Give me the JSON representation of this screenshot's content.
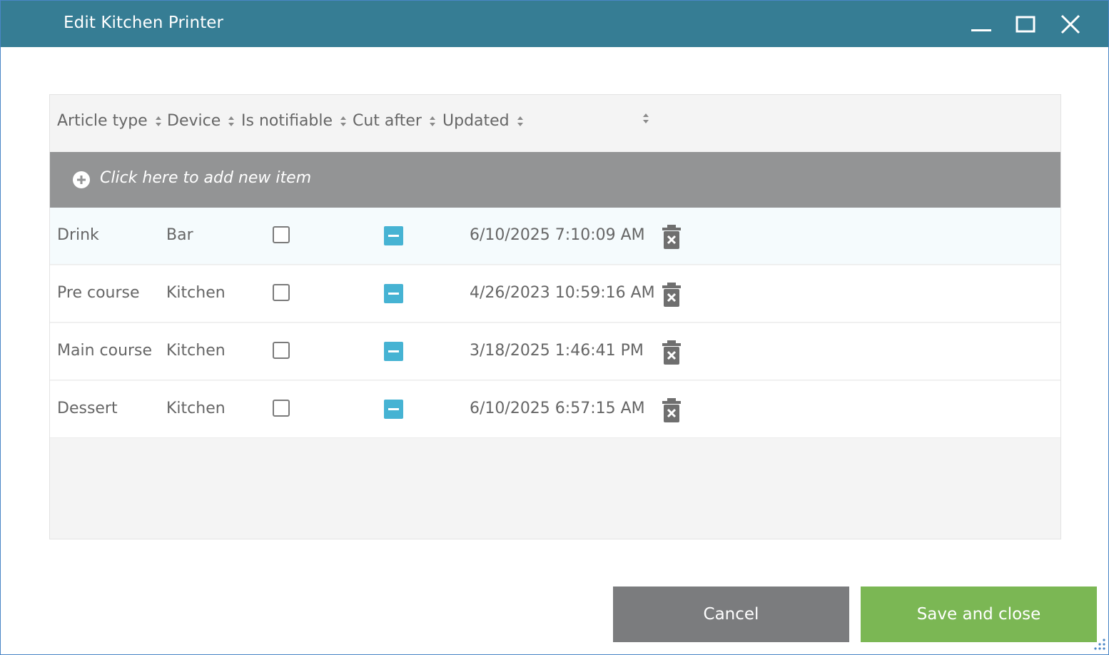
{
  "window": {
    "title": "Edit Kitchen Printer",
    "controls": [
      "minimize-icon",
      "maximize-icon",
      "close-icon"
    ]
  },
  "grid": {
    "columns": [
      {
        "label": "Article type"
      },
      {
        "label": "Device"
      },
      {
        "label": "Is notifiable"
      },
      {
        "label": "Cut after"
      },
      {
        "label": "Updated"
      },
      {
        "label": ""
      }
    ],
    "add_label": "Click here to add new item",
    "rows": [
      {
        "article_type": "Drink",
        "device": "Bar",
        "is_notifiable": false,
        "cut_after": "indeterminate",
        "updated": "6/10/2025 7:10:09 AM",
        "selected": true
      },
      {
        "article_type": "Pre course",
        "device": "Kitchen",
        "is_notifiable": false,
        "cut_after": "indeterminate",
        "updated": "4/26/2023 10:59:16 AM"
      },
      {
        "article_type": "Main course",
        "device": "Kitchen",
        "is_notifiable": false,
        "cut_after": "indeterminate",
        "updated": "3/18/2025 1:46:41 PM"
      },
      {
        "article_type": "Dessert",
        "device": "Kitchen",
        "is_notifiable": false,
        "cut_after": "indeterminate",
        "updated": "6/10/2025 6:57:15 AM"
      }
    ]
  },
  "buttons": {
    "cancel": "Cancel",
    "save": "Save and close"
  },
  "colors": {
    "titlebar": "#367d94",
    "add_row": "#939495",
    "cut_after_toggle": "#46b3d3",
    "save_button": "#7bb754",
    "cancel_button": "#7b7c7e"
  }
}
